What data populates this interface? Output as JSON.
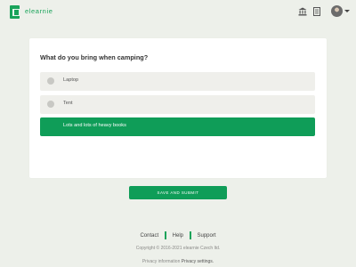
{
  "header": {
    "brand": "elearnie",
    "icons": [
      "bank-icon",
      "book-icon",
      "avatar",
      "chevron-down-icon"
    ]
  },
  "quiz": {
    "question": "What do you bring when camping?",
    "options": [
      {
        "label": "Laptop",
        "selected": false
      },
      {
        "label": "Tent",
        "selected": false
      },
      {
        "label": "Lots and lots of heavy books",
        "selected": true
      }
    ],
    "submit_label": "SAVE AND SUBMIT"
  },
  "footer": {
    "links": [
      "Contact",
      "Help",
      "Support"
    ],
    "copyright": "Copyright © 2016-2021 elearnie Czech ltd.",
    "privacy_info": "Privacy information",
    "privacy_settings": "Privacy settings."
  },
  "colors": {
    "accent": "#0f9d58",
    "background": "#edf0ea",
    "option_bg": "#efefeb"
  }
}
